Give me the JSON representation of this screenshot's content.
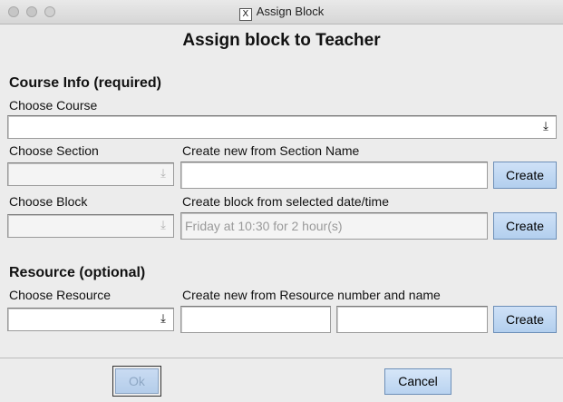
{
  "window": {
    "title": "Assign Block",
    "x_glyph": "X"
  },
  "heading": "Assign block to Teacher",
  "course_info": {
    "title": "Course Info (required)",
    "choose_course_label": "Choose Course",
    "choose_course_value": "",
    "choose_section_label": "Choose Section",
    "new_section_label": "Create new from Section Name",
    "new_section_value": "",
    "create_section_button": "Create",
    "choose_block_label": "Choose Block",
    "new_block_label": "Create block from selected date/time",
    "new_block_placeholder": "Friday at 10:30 for 2 hour(s)",
    "create_block_button": "Create"
  },
  "resource": {
    "title": "Resource (optional)",
    "choose_resource_label": "Choose Resource",
    "new_resource_label": "Create new from Resource number and name",
    "resource_number_value": "",
    "resource_name_value": "",
    "create_resource_button": "Create"
  },
  "footer": {
    "ok_button": "Ok",
    "cancel_button": "Cancel"
  },
  "icons": {
    "dropdown": "download-arrow-icon",
    "close": "close-icon",
    "minimize": "minimize-icon",
    "maximize": "maximize-icon"
  }
}
